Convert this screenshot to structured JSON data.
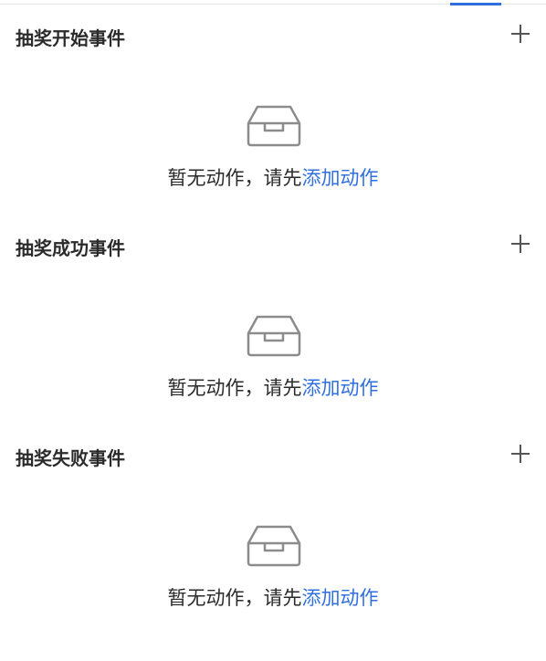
{
  "sections": [
    {
      "title": "抽奖开始事件",
      "empty_text": "暂无动作，请先",
      "link_text": "添加动作"
    },
    {
      "title": "抽奖成功事件",
      "empty_text": "暂无动作，请先",
      "link_text": "添加动作"
    },
    {
      "title": "抽奖失败事件",
      "empty_text": "暂无动作，请先",
      "link_text": "添加动作"
    }
  ],
  "icons": {
    "add": "plus-icon",
    "empty": "empty-inbox-icon"
  },
  "colors": {
    "accent": "#2f6fe0",
    "text": "#2b2b2b",
    "icon": "#8c8c8c",
    "divider": "#e6e6e6"
  }
}
